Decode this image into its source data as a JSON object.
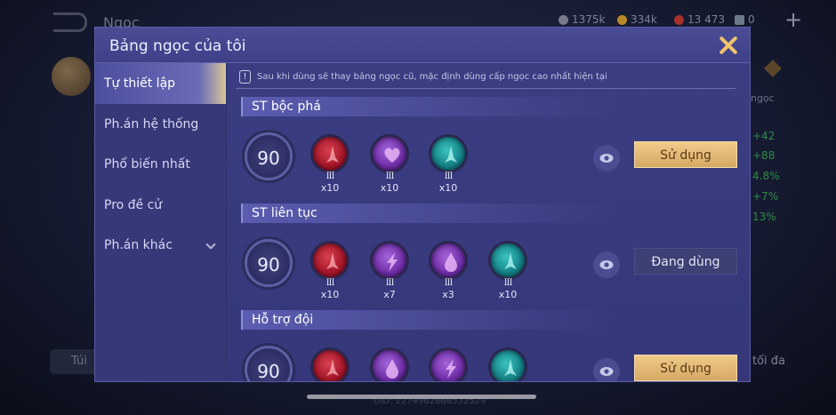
{
  "background": {
    "title": "Ngọc",
    "resources": [
      {
        "icon": "coin-icon",
        "value": "1375k",
        "color": "#7a7a88"
      },
      {
        "icon": "gold-icon",
        "value": "334k",
        "color": "#b88a2a"
      },
      {
        "icon": "gem-icon",
        "value": "13 473",
        "color": "#a8322a"
      },
      {
        "icon": "voucher-icon",
        "value": "0",
        "color": "#6a7a88"
      }
    ],
    "right_label": "ngọc",
    "right_stats": [
      "+42",
      "+88",
      "4.8%",
      "+7%",
      "13%"
    ],
    "bag_label": "Túi",
    "max_label": "tối đa",
    "uid": "UID: 2274962868532529"
  },
  "modal": {
    "title": "Bảng ngọc của tôi",
    "sidebar": [
      {
        "label": "Tự thiết lập",
        "active": true
      },
      {
        "label": "Ph.án hệ thống"
      },
      {
        "label": "Phổ biến nhất"
      },
      {
        "label": "Pro đề cử"
      },
      {
        "label": "Ph.án khác",
        "has_dropdown": true
      }
    ],
    "notice": "Sau khi dùng sẽ thay bảng ngọc cũ, mặc định dùng cấp ngọc cao nhất hiện tại",
    "notice_icon": "!",
    "sets": [
      {
        "name": "ST bộc phá",
        "level": "90",
        "runes": [
          {
            "color": "red",
            "icon": "sword-rune-icon",
            "tier": "III",
            "count": "x10"
          },
          {
            "color": "purple",
            "icon": "heart-rune-icon",
            "tier": "III",
            "count": "x10"
          },
          {
            "color": "teal",
            "icon": "sword-rune-icon",
            "tier": "III",
            "count": "x10"
          }
        ],
        "action": "Sử dụng",
        "in_use": false
      },
      {
        "name": "ST liên tục",
        "level": "90",
        "runes": [
          {
            "color": "red",
            "icon": "sword-rune-icon",
            "tier": "III",
            "count": "x10"
          },
          {
            "color": "purple",
            "icon": "lightning-rune-icon",
            "tier": "III",
            "count": "x7"
          },
          {
            "color": "purple",
            "icon": "drop-rune-icon",
            "tier": "III",
            "count": "x3"
          },
          {
            "color": "teal",
            "icon": "sword-rune-icon",
            "tier": "III",
            "count": "x10"
          }
        ],
        "action": "Đang dùng",
        "in_use": true
      },
      {
        "name": "Hỗ trợ đội",
        "level": "90",
        "runes": [
          {
            "color": "red",
            "icon": "sword-rune-icon",
            "tier": "III",
            "count": ""
          },
          {
            "color": "purple",
            "icon": "drop-rune-icon",
            "tier": "III",
            "count": ""
          },
          {
            "color": "purple",
            "icon": "lightning-rune-icon",
            "tier": "III",
            "count": ""
          },
          {
            "color": "teal",
            "icon": "sword-rune-icon",
            "tier": "III",
            "count": ""
          }
        ],
        "action": "Sử dụng",
        "in_use": false
      }
    ]
  }
}
